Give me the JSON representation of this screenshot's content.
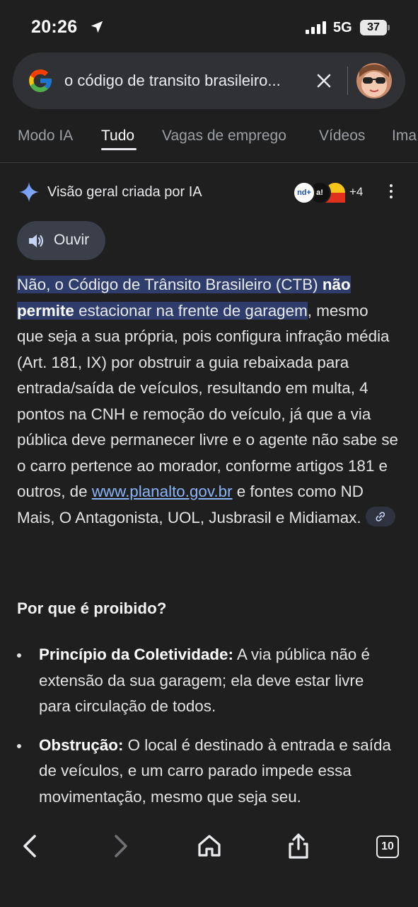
{
  "status_bar": {
    "time": "20:26",
    "network": "5G",
    "battery": "37"
  },
  "search": {
    "query": "o código de transito brasileiro..."
  },
  "tabs": [
    {
      "label": "Modo IA"
    },
    {
      "label": "Tudo"
    },
    {
      "label": "Vagas de emprego"
    },
    {
      "label": "Vídeos"
    },
    {
      "label": "Ima"
    }
  ],
  "ai_overview": {
    "title": "Visão geral criada por IA",
    "sources_more": "+4",
    "source_icons": [
      "nd+",
      "a!"
    ],
    "listen_label": "Ouvir",
    "answer": {
      "hl1": "Não, o Código de Trânsito Brasileiro (CTB) ",
      "hl2": "não permite",
      "hl3": " estacionar na frente de garagem",
      "rest1": ", mesmo que seja a sua própria, pois configura infração média (Art. 181, IX) por obstruir a guia rebaixada para entrada/saída de veículos, resultando em multa, 4 pontos na CNH e remoção do veículo, já que a via pública deve permanecer livre e o agente não sabe se o carro pertence ao morador, conforme artigos 181 e outros, de ",
      "link": "www.planalto.gov.br",
      "rest2": " e fontes como ND Mais, O Antagonista, UOL, Jusbrasil e Midiamax."
    },
    "section_title": "Por que é proibido?",
    "bullets": [
      {
        "title": "Princípio da Coletividade:",
        "text": " A via pública não é extensão da sua garagem; ela deve estar livre para circulação de todos."
      },
      {
        "title": "Obstrução:",
        "text": " O local é destinado à entrada e saída de veículos, e um carro parado impede essa movimentação, mesmo que seja seu."
      }
    ]
  },
  "bottom_bar": {
    "tab_count": "10"
  },
  "colors": {
    "background": "#1f1f1f",
    "highlight": "#2e3d6b",
    "link": "#8ab4f8"
  }
}
